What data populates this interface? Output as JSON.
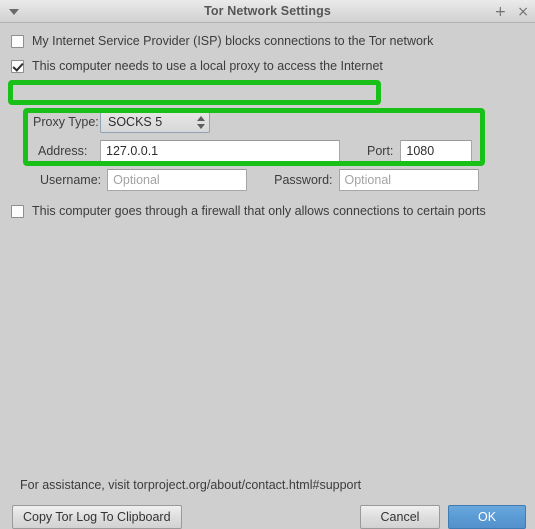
{
  "window": {
    "title": "Tor Network Settings",
    "menu_icon": "triangle-down-icon",
    "maximize_icon": "plus-icon",
    "close_icon": "close-icon",
    "maximize_glyph": "+",
    "close_glyph": "×"
  },
  "options": {
    "isp_blocks": {
      "label": "My Internet Service Provider (ISP) blocks connections to the Tor network",
      "checked": false
    },
    "local_proxy": {
      "label": "This computer needs to use a local proxy to access the Internet",
      "checked": true
    },
    "firewall": {
      "label": "This computer goes through a firewall that only allows connections to certain ports",
      "checked": false
    }
  },
  "proxy": {
    "type_label": "Proxy Type:",
    "type_value": "SOCKS 5",
    "address_label": "Address:",
    "address_value": "127.0.0.1",
    "port_label": "Port:",
    "port_value": "1080",
    "username_label": "Username:",
    "username_value": "",
    "username_placeholder": "Optional",
    "password_label": "Password:",
    "password_value": "",
    "password_placeholder": "Optional"
  },
  "footer": {
    "assistance_text": "For assistance, visit torproject.org/about/contact.html#support",
    "copy_log_label": "Copy Tor Log To Clipboard",
    "cancel_label": "Cancel",
    "ok_label": "OK"
  },
  "annotations": {
    "accent_color": "#18c018",
    "count": 2
  },
  "colors": {
    "window_background": "#cfcfcf",
    "titlebar": "#dcdcdc",
    "primary_button": "#5b9bd5",
    "field_background": "#ffffff",
    "placeholder_text": "#a3a3a3"
  }
}
